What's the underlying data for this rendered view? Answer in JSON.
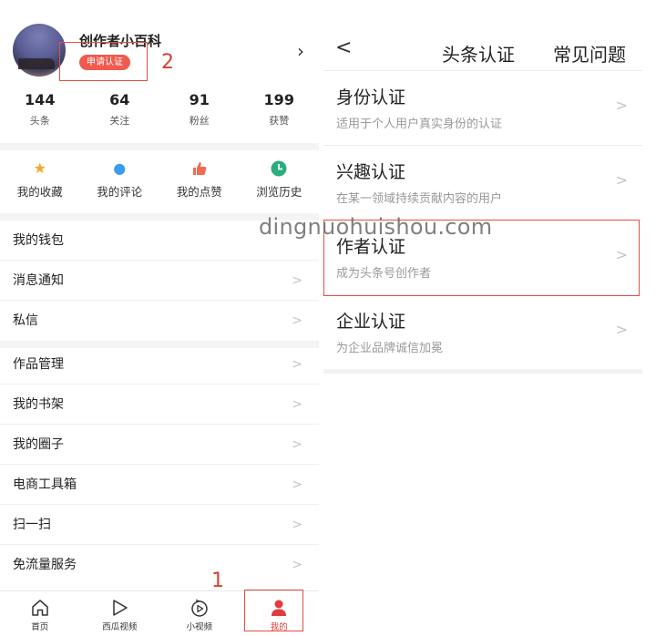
{
  "profile": {
    "username": "创作者小百科",
    "apply_label": "申请认证",
    "annotation_2": "2",
    "chevron": "›"
  },
  "stats": [
    {
      "value": "144",
      "label": "头条"
    },
    {
      "value": "64",
      "label": "关注"
    },
    {
      "value": "91",
      "label": "粉丝"
    },
    {
      "value": "199",
      "label": "获赞"
    }
  ],
  "quick_actions": [
    {
      "label": "我的收藏",
      "icon": "star-icon",
      "glyph": "★",
      "color": "#f5a623"
    },
    {
      "label": "我的评论",
      "icon": "comment-icon",
      "glyph": "●",
      "color": "#3d9be9"
    },
    {
      "label": "我的点赞",
      "icon": "thumbs-up-icon",
      "glyph": "👍",
      "color": "#f26b4f"
    },
    {
      "label": "浏览历史",
      "icon": "clock-icon",
      "glyph": "◷",
      "color": "#2bae7f"
    }
  ],
  "menu_group_1": [
    {
      "label": "我的钱包",
      "chevron": ""
    },
    {
      "label": "消息通知",
      "chevron": ">"
    },
    {
      "label": "私信",
      "chevron": ">"
    }
  ],
  "menu_group_2": [
    {
      "label": "作品管理",
      "chevron": ">"
    },
    {
      "label": "我的书架",
      "chevron": ">"
    },
    {
      "label": "我的圈子",
      "chevron": ">"
    },
    {
      "label": "电商工具箱",
      "chevron": ">"
    },
    {
      "label": "扫一扫",
      "chevron": ">"
    },
    {
      "label": "免流量服务",
      "chevron": ">"
    }
  ],
  "tabbar": [
    {
      "label": "首页",
      "icon": "home-icon"
    },
    {
      "label": "西瓜视频",
      "icon": "play-icon"
    },
    {
      "label": "小视频",
      "icon": "small-video-icon"
    },
    {
      "label": "我的",
      "icon": "user-icon",
      "active": true
    }
  ],
  "annotation_1": "1",
  "watermark": "dingnuohuishou.com",
  "cert_page": {
    "back": "<",
    "title": "头条认证",
    "faq": "常见问题",
    "items": [
      {
        "title": "身份认证",
        "desc": "适用于个人用户真实身份的认证"
      },
      {
        "title": "兴趣认证",
        "desc": "在某一领域持续贡献内容的用户"
      },
      {
        "title": "作者认证",
        "desc": "成为头条号创作者"
      },
      {
        "title": "企业认证",
        "desc": "为企业品牌诚信加冕"
      }
    ],
    "chevron": ">"
  },
  "colors": {
    "accent": "#e4393c",
    "annotation": "#d8412f",
    "badge": "#f05a4f"
  }
}
